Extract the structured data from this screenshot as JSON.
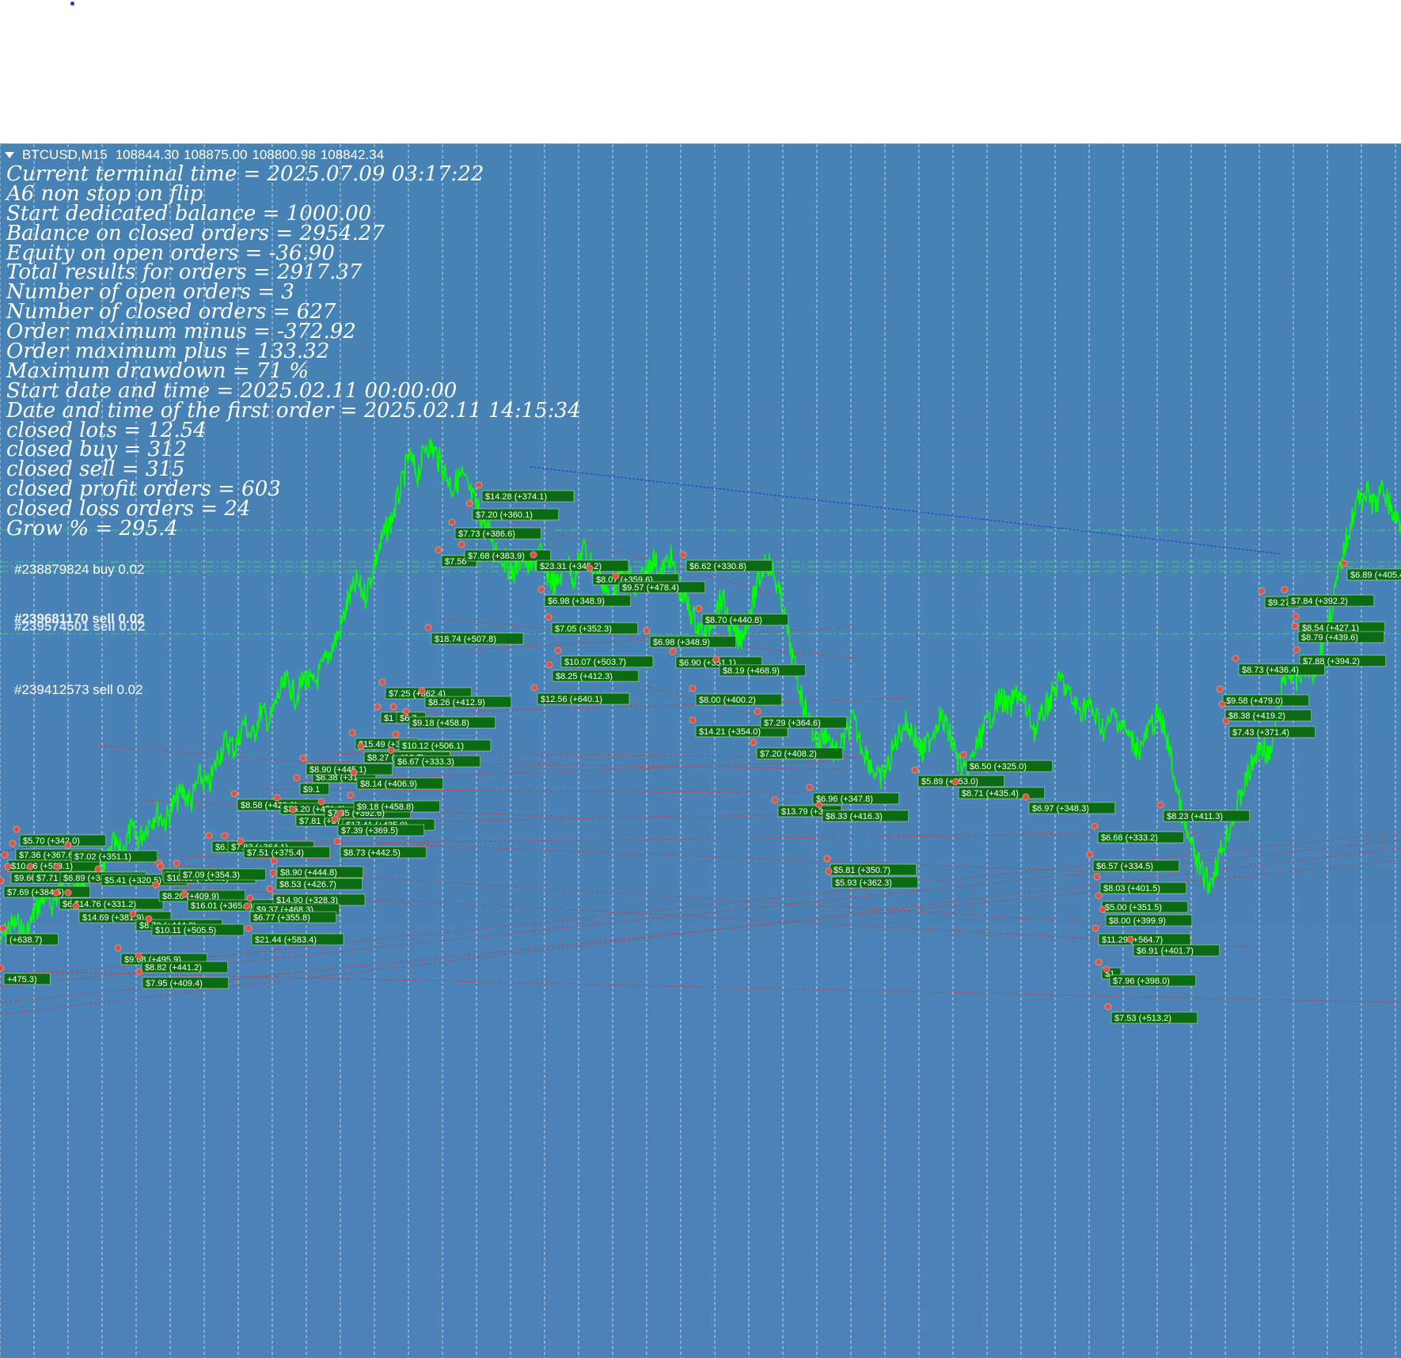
{
  "chart_window": {
    "symbol": "BTCUSD,M15",
    "open": "108844.30",
    "high": "108875.00",
    "low": "108800.98",
    "close": "108842.34"
  },
  "info_lines": [
    "Current terminal time = 2025.07.09 03:17:22",
    "A6 non stop on flip",
    "Start dedicated balance = 1000.00",
    "Balance on closed orders = 2954.27",
    "Equity on open orders = -36.90",
    "Total results for orders = 2917.37",
    "Number of open orders = 3",
    "Number of closed orders = 627",
    "Order maximum minus = -372.92",
    "Order maximum plus = 133.32",
    "Maximum drawdown = 71 %",
    "Start date and time = 2025.02.11 00:00:00",
    "Date and time of the first order = 2025.02.11 14:15:34",
    "closed lots = 12.54",
    "closed buy = 312",
    "closed sell = 315",
    "closed profit orders = 603",
    "closed loss orders = 24",
    "Grow % = 295.4"
  ],
  "order_lines": [
    "#238879824 buy 0.02",
    "#239681170 sell 0.02",
    "#239574501 sell 0.02",
    "#239412573 sell 0.02"
  ],
  "colors": {
    "background": "#4682b4",
    "price_line": "#00ff00",
    "label_bg": "#0b6b12",
    "closed_trade_line": "#c83c3c",
    "open_trade_line": "#1e3fd6",
    "order_level_line": "#3fd06a"
  },
  "chart_data": {
    "type": "line",
    "title": "BTCUSD,M15",
    "series": [
      {
        "values": [
          101.2,
          101.9,
          102.0,
          101.5,
          102.6,
          103.2,
          102.9,
          103.6,
          103.9,
          103.5,
          104.2,
          104.8,
          104.4,
          105.6,
          105.1,
          106.2,
          105.8,
          106.5,
          107.0,
          106.6,
          107.4,
          107.9,
          107.5,
          108.6,
          108.1,
          109.4,
          110.2,
          109.8,
          111.0,
          110.3,
          111.5,
          111.0,
          112.2,
          112.8,
          112.1,
          113.0,
          112.6,
          113.4,
          114.2,
          115.0,
          116.4,
          117.2,
          116.6,
          118.0,
          119.2,
          120.0,
          121.3,
          122.8,
          122.0,
          123.4,
          123.0,
          122.2,
          121.4,
          122.0,
          121.2,
          120.4,
          119.6,
          118.8,
          118.2,
          117.6,
          118.4,
          117.8,
          118.6,
          117.5,
          117.0,
          118.2,
          117.4,
          118.8,
          118.0,
          117.6,
          116.4,
          117.2,
          117.9,
          116.8,
          117.5,
          118.3,
          117.6,
          118.4,
          117.0,
          116.2,
          115.4,
          114.8,
          115.8,
          116.5,
          115.2,
          114.6,
          115.7,
          117.0,
          118.3,
          117.5,
          116.0,
          114.0,
          112.3,
          111.0,
          110.0,
          110.6,
          109.5,
          110.2,
          111.1,
          110.0,
          109.2,
          108.4,
          109.0,
          110.2,
          111.0,
          110.5,
          109.6,
          110.4,
          111.3,
          110.6,
          109.4,
          108.6,
          109.7,
          110.6,
          111.4,
          112.1,
          111.6,
          112.4,
          111.5,
          110.6,
          111.5,
          112.3,
          112.9,
          112.1,
          111.5,
          111.8,
          111.2,
          110.6,
          111.4,
          110.8,
          110.2,
          109.8,
          110.6,
          111.3,
          110.5,
          108.5,
          106.4,
          105.4,
          104.4,
          103.8,
          104.9,
          106.0,
          107.0,
          108.2,
          109.2,
          110.0,
          109.4,
          112.0,
          113.4,
          112.8,
          113.6,
          113.2,
          114.6,
          116.0,
          117.8,
          119.6,
          120.8,
          121.2,
          120.6,
          121.4,
          120.3,
          119.8
        ]
      }
    ],
    "trade_labels": [
      "$5.70 (+342.0)",
      "$7.36 (+367.6)",
      "$10.46 (+523.1)",
      "$9.60 (+3",
      "$7.71",
      "$7.69 (+384.5)",
      "$6.89 (+344.3)",
      "$7.02 (+351.1)",
      "$5.41 (+320.5)",
      "$6.4",
      "$14.76 (+331.2)",
      "$14.69 (+381.9)",
      "(+638.7)",
      "+475.3)",
      "$8.70 (+444.8)",
      "$10.11 (+505.5)",
      "$9.68 (+495.9)",
      "$8.82 (+441.2)",
      "$7.95 (+409.4)",
      "$5.0",
      "$10.09 (+504.3)",
      "$7.09 (+354.3)",
      "$8.20 (+409.9)",
      "$16.01 (+365.8)",
      "$6.6",
      "$7.83 (+364.1)",
      "$7.51 (+375.4)",
      "$8.58 (+429.0)",
      "$36.20 (+451.0)",
      "$9.1",
      "$6.38 (+31",
      "$7.81 (+37",
      "$7.85 (+392.6)",
      "$17.41 (+435.0)",
      "$7.39 (+369.5)",
      "$8.90 (+444.8)",
      "$8.53 (+426.7)",
      "$14.90 (+328.3)",
      "$9.37 (+468.3)",
      "$6.77 (+355.8)",
      "$21.44 (+583.4)",
      "$8.73 (+442.5)",
      "$8.90 (+445.1)",
      "$8.14 (+406.9)",
      "$9.18 (+458.8)",
      "$15.49 (+3",
      "$8.27 (+413.7)",
      "$6.67 (+333.3)",
      "$10.12 (+506.1)",
      "$1",
      "$6.7",
      "$9.18 (+458.8)",
      "$7.25 (+362.4)",
      "$8.26 (+412.9)",
      "$18.74 (+507.8)",
      "$7.56",
      "$7.68 (+383.9)",
      "$7.73 (+386.6)",
      "$7.20 (+360.1)",
      "$14.28 (+374.1)",
      "$23.31 (+345.2)",
      "$8.07 (+359.6)",
      "$9.57 (+478.4)",
      "$6.98 (+348.9)",
      "$7.05 (+352.3)",
      "$10.07 (+503.7)",
      "$8.25 (+412.3)",
      "$12.56 (+640.1)",
      "$6.62 (+330.8)",
      "$8.70 (+440.8)",
      "$6.98 (+348.9)",
      "$6.90 (+351.1)",
      "$8.19 (+468.9)",
      "$8.00 (+400.2)",
      "$14.21 (+354.0)",
      "$7.29 (+364.6)",
      "$7.20 (+408.2)",
      "$6.96 (+347.8)",
      "$13.79 (+3",
      "$8.33 (+416.3)",
      "$5.81 (+350.7)",
      "$5.93 (+362.3)",
      "$5.89 (+353.0)",
      "$6.50 (+325.0)",
      "$8.71 (+435.4)",
      "$6.97 (+348.3)",
      "$8.23 (+411.3)",
      "$6.66 (+333.2)",
      "$6.57 (+334.5)",
      "$8.03 (+401.5)",
      "$5.00 (+351.5)",
      "$8.00 (+399.9)",
      "$11.29 (+564.7)",
      "$6.91 (+401.7)",
      "$1",
      "$7.96 (+398.0)",
      "$7.53 (+513.2)",
      "$9.27",
      "$7.84 (+392.2)",
      "$6.89 (+405.4)",
      "$8.54 (+427.1)",
      "$8.79 (+439.6)",
      "$7.88 (+394.2)",
      "$8.73 (+436.4)",
      "$9.58 (+479.0)",
      "$8.38 (+419.2)",
      "$7.43 (+371.4)"
    ]
  }
}
